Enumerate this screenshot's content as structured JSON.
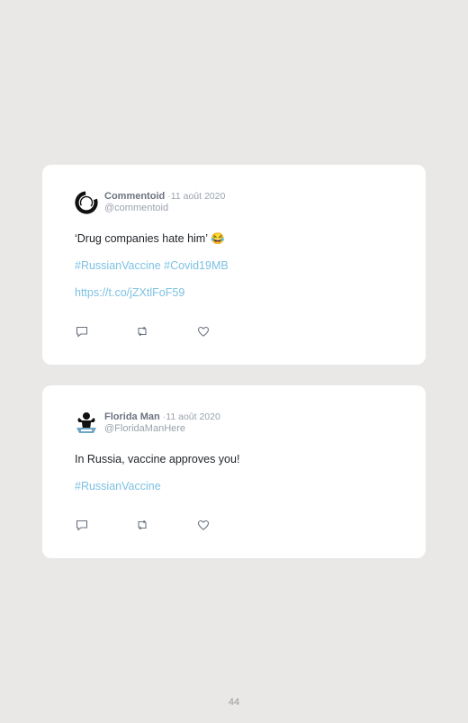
{
  "tweets": [
    {
      "author": "Commentoid",
      "separator": "·",
      "date": "11 août 2020",
      "handle": "@commentoid",
      "lines": [
        "‘Drug companies hate him’ 😂",
        "#RussianVaccine #Covid19MB",
        "https://t.co/jZXtlFoF59"
      ],
      "avatar_icon": "ring-logo-icon"
    },
    {
      "author": "Florida Man",
      "separator": "·",
      "date": "11 août 2020",
      "handle": "@FloridaManHere",
      "lines": [
        "In Russia, vaccine approves you!",
        "#RussianVaccine"
      ],
      "avatar_icon": "flexing-man-icon"
    }
  ],
  "actions": [
    "reply-icon",
    "retweet-icon",
    "like-icon"
  ],
  "colors": {
    "background": "#e9e8e6",
    "card": "#ffffff",
    "link": "#7dc1e3",
    "name": "#6b7380",
    "muted": "#9aa2ad"
  },
  "page_number": "44"
}
